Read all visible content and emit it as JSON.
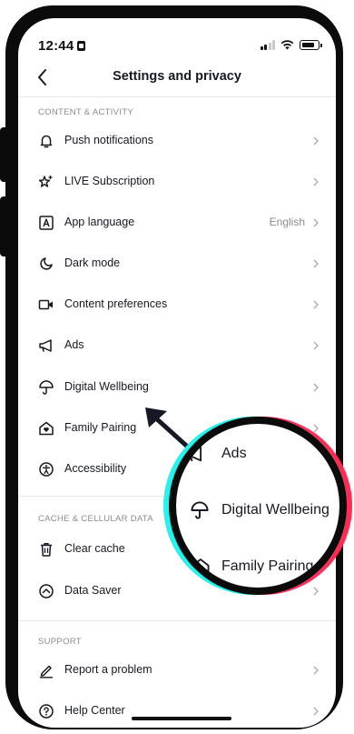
{
  "status_bar": {
    "time": "12:44",
    "lock_icon": "orientation-lock-icon",
    "signal_icon": "cellular-signal-icon",
    "wifi_icon": "wifi-icon",
    "battery_icon": "battery-icon"
  },
  "nav": {
    "back_icon": "chevron-left-icon",
    "title": "Settings and privacy"
  },
  "sections": {
    "content_activity": {
      "header": "CONTENT & ACTIVITY",
      "items": [
        {
          "label": "Push notifications",
          "icon": "bell-icon"
        },
        {
          "label": "LIVE Subscription",
          "icon": "star-sparkle-icon"
        },
        {
          "label": "App language",
          "icon": "language-a-icon",
          "value": "English"
        },
        {
          "label": "Dark mode",
          "icon": "moon-icon"
        },
        {
          "label": "Content preferences",
          "icon": "video-camera-icon"
        },
        {
          "label": "Ads",
          "icon": "megaphone-icon"
        },
        {
          "label": "Digital Wellbeing",
          "icon": "umbrella-icon"
        },
        {
          "label": "Family Pairing",
          "icon": "home-heart-icon"
        },
        {
          "label": "Accessibility",
          "icon": "accessibility-icon"
        }
      ]
    },
    "cache": {
      "header": "CACHE & CELLULAR DATA",
      "items": [
        {
          "label": "Clear cache",
          "icon": "trash-icon"
        },
        {
          "label": "Data Saver",
          "icon": "data-saver-icon"
        }
      ]
    },
    "support": {
      "header": "SUPPORT",
      "items": [
        {
          "label": "Report a problem",
          "icon": "pencil-icon"
        },
        {
          "label": "Help Center",
          "icon": "help-circle-icon"
        }
      ]
    }
  },
  "magnifier": {
    "items": [
      {
        "label": "Ads",
        "icon": "megaphone-icon"
      },
      {
        "label": "Digital Wellbeing",
        "icon": "umbrella-icon"
      },
      {
        "label": "Family Pairing",
        "icon": "home-heart-icon"
      }
    ],
    "ring_colors": {
      "cyan": "#25f4ee",
      "red": "#fe2c55",
      "black": "#0b0b0b"
    }
  },
  "colors": {
    "text_primary": "#161823",
    "text_secondary": "#8a8b91",
    "divider": "#e9e9ea",
    "frame": "#0b0b0b"
  }
}
